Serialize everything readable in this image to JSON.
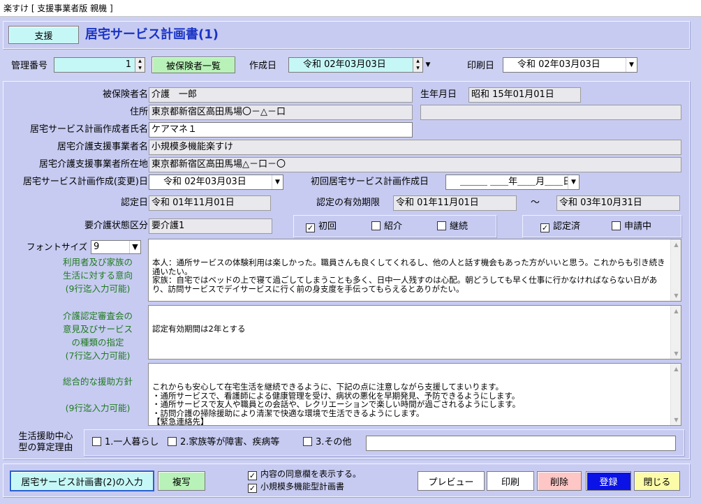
{
  "window": {
    "title": "楽すけ [ 支援事業者版 親機 ]"
  },
  "header": {
    "mode_button": "支援",
    "page_title": "居宅サービス計画書(1)"
  },
  "top": {
    "kanri_label": "管理番号",
    "kanri_value": "1",
    "hihoken_list_button": "被保険者一覧",
    "sakusei_label": "作成日",
    "sakusei_value": "令和  02年03月03日",
    "insatsu_label": "印刷日",
    "insatsu_value": "令和  02年03月03日"
  },
  "form": {
    "hihoken_name_label": "被保険者名",
    "hihoken_name": "介護　一郎",
    "birth_label": "生年月日",
    "birth_value": "昭和 15年01月01日",
    "address_label": "住所",
    "address_value": "東京都新宿区高田馬場〇－△－口",
    "address_extra": "",
    "planner_label": "居宅サービス計画作成者氏名",
    "planner_value": "ケアマネ１",
    "jigyosha_label": "居宅介護支援事業者名",
    "jigyosha_value": "小規模多機能楽すけ",
    "jigyosha_addr_label": "居宅介護支援事業者所在地",
    "jigyosha_addr_value": "東京都新宿区高田馬場△－口－〇",
    "plan_date_label": "居宅サービス計画作成(変更)日",
    "plan_date_value": "令和  02年03月03日",
    "first_plan_label": "初回居宅サービス計画作成日",
    "first_plan_value": "＿＿＿  ＿＿年＿＿月＿＿日",
    "nintei_label": "認定日",
    "nintei_value": "令和 01年11月01日",
    "yuko_label": "認定の有効期限",
    "yuko_from": "令和 01年11月01日",
    "tilde": "〜",
    "yuko_to": "令和 03年10月31日",
    "kaigodo_label": "要介護状態区分",
    "kaigodo_value": "要介護1",
    "type_checks": {
      "shokai": "初回",
      "shokai_mark": "✓",
      "shokai2": "紹介",
      "shokai2_mark": "",
      "keizoku": "継続",
      "keizoku_mark": ""
    },
    "status_checks": {
      "ninteizumi": "認定済",
      "ninteizumi_mark": "✓",
      "shinseichu": "申請中",
      "shinseichu_mark": ""
    },
    "font_size_label": "フォントサイズ",
    "font_size_value": "9"
  },
  "memos": {
    "intent_label": "利用者及び家族の\n生活に対する意向\n(9行迄入力可能)",
    "intent_text": "本人：通所サービスの体験利用は楽しかった。職員さんも良くしてくれるし、他の人と話す機会もあった方がいいと思う。これからも引き続き通いたい。\n家族：自宅ではベッドの上で寝て過ごしてしまうことも多く、日中一人残すのは心配。朝どうしても早く仕事に行かなければならない日があり、訪問サービスでデイサービスに行く前の身支度を手伝ってもらえるとありがたい。",
    "opinion_label": "介護認定審査会の\n意見及びサービス\nの種類の指定\n(7行迄入力可能)",
    "opinion_text": "認定有効期間は2年とする",
    "policy_label": "総合的な援助方針\n\n(9行迄入力可能)",
    "policy_text": "これからも安心して在宅生活を継続できるように、下記の点に注意しながら支援してまいります。\n・通所サービスで、看護師による健康管理を受け、病状の悪化を早期発見、予防できるようにします。\n・通所サービスで友人や職員との会話や、レクリエーションで楽しい時間が過ごされるようにします。\n・訪問介護の掃除援助により清潔で快適な環境で生活できるようにします。\n【緊急連絡先】\n〇〇　〇〇　　（TEL：　　　　　　　　）\n主治医"
  },
  "support_reason": {
    "label": "生活援助中心\n型の算定理由",
    "opt1": "1.一人暮らし",
    "opt1_mark": "",
    "opt2": "2.家族等が障害、疾病等",
    "opt2_mark": "",
    "opt3": "3.その他",
    "opt3_mark": "",
    "other_text": ""
  },
  "footer": {
    "plan2_button": "居宅サービス計画書(2)の入力",
    "copy_button": "複写",
    "consent_check": "内容の同意欄を表示する。",
    "consent_mark": "✓",
    "small_multi_check": "小規模多機能型計画書",
    "small_multi_mark": "✓",
    "preview_button": "プレビュー",
    "print_button": "印刷",
    "delete_button": "削除",
    "register_button": "登録",
    "close_button": "閉じる"
  },
  "colors": {
    "background": "#ccd0f2",
    "cyan_button": "#c6f7f7",
    "green_button": "#b8f2b8",
    "title_blue": "#1a33c4",
    "label_green": "#1f7a1f",
    "register_blue": "#0a12e6",
    "close_yellow": "#fbfba8",
    "delete_pink": "#ffc6c6"
  }
}
